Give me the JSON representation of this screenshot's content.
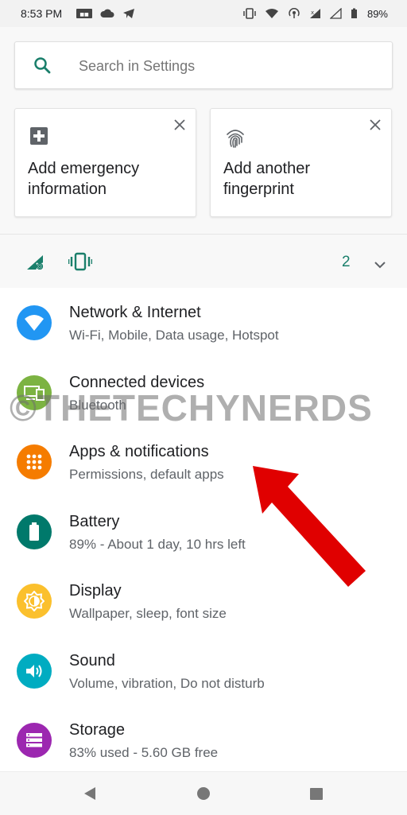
{
  "status": {
    "time": "8:53 PM",
    "battery_text": "89%"
  },
  "search": {
    "placeholder": "Search in Settings"
  },
  "suggestions": [
    {
      "text": "Add emergency information",
      "icon": "plus-box-icon"
    },
    {
      "text": "Add another fingerprint",
      "icon": "fingerprint-icon"
    }
  ],
  "conditions": {
    "count": "2"
  },
  "items": [
    {
      "title": "Network & Internet",
      "subtitle": "Wi-Fi, Mobile, Data usage, Hotspot",
      "color": "#2196F3",
      "icon": "wifi-icon"
    },
    {
      "title": "Connected devices",
      "subtitle": "Bluetooth",
      "color": "#7CB342",
      "icon": "devices-icon"
    },
    {
      "title": "Apps & notifications",
      "subtitle": "Permissions, default apps",
      "color": "#F57C00",
      "icon": "apps-grid-icon"
    },
    {
      "title": "Battery",
      "subtitle": "89% - About 1 day, 10 hrs left",
      "color": "#00796B",
      "icon": "battery-icon"
    },
    {
      "title": "Display",
      "subtitle": "Wallpaper, sleep, font size",
      "color": "#FBC02D",
      "icon": "brightness-icon"
    },
    {
      "title": "Sound",
      "subtitle": "Volume, vibration, Do not disturb",
      "color": "#00ACC1",
      "icon": "volume-icon"
    },
    {
      "title": "Storage",
      "subtitle": "83% used - 5.60 GB free",
      "color": "#9C27B0",
      "icon": "storage-icon"
    }
  ],
  "watermark": "©THETECHYNERDS",
  "colors": {
    "accent": "#1a7f6b",
    "arrow": "#E00000"
  }
}
